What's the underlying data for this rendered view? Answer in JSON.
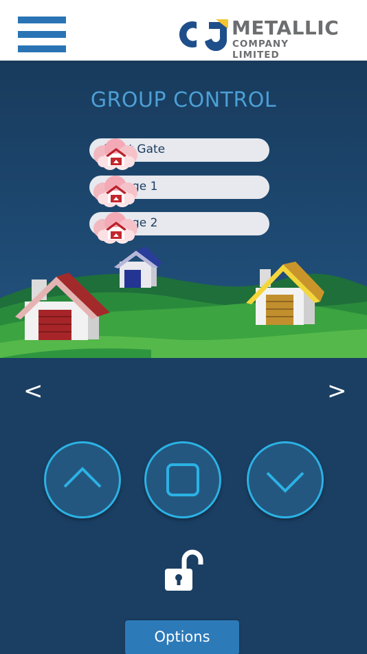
{
  "header": {
    "menu_icon": "hamburger-menu-icon",
    "logo": {
      "mark": "CJ",
      "line1": "METALLIC",
      "line2": "COMPANY LIMITED"
    }
  },
  "main": {
    "title": "GROUP CONTROL",
    "groups": [
      {
        "label": "Front Gate",
        "icon": "cloud-garage-icon"
      },
      {
        "label": "Garage 1",
        "icon": "cloud-garage-icon"
      },
      {
        "label": "Garage 2",
        "icon": "cloud-garage-icon"
      }
    ],
    "nav": {
      "prev": "<",
      "next": ">"
    },
    "controls": {
      "up_icon": "chevron-up-icon",
      "stop_icon": "stop-square-icon",
      "down_icon": "chevron-down-icon"
    },
    "lock_icon": "unlocked-padlock-icon",
    "options_label": "Options"
  },
  "colors": {
    "background": "#1b3f63",
    "accent": "#2bb2e5",
    "title": "#4d9fd6",
    "menu": "#2a74b5",
    "options_button": "#2d7ab9"
  }
}
